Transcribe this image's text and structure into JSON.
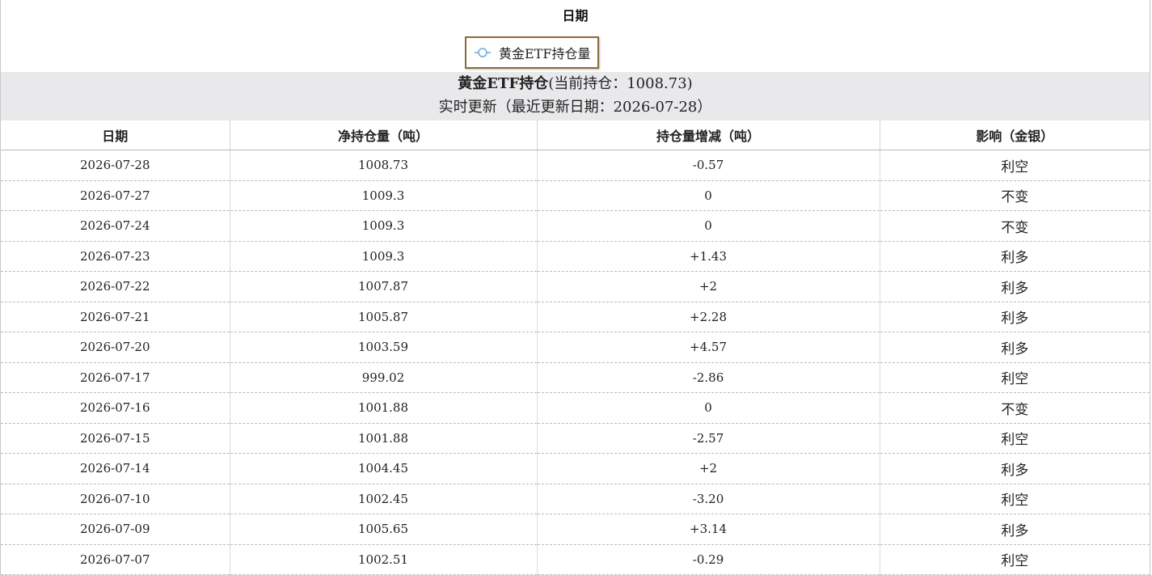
{
  "header": {
    "top_label": "日期",
    "legend_label": "黄金ETF持仓量"
  },
  "summary": {
    "title_bold": "黄金ETF持仓",
    "title_rest": "(当前持仓：1008.73)",
    "update_line": "实时更新（最近更新日期：2026-07-28）"
  },
  "table": {
    "columns": [
      "日期",
      "净持仓量（吨）",
      "持仓量增减（吨）",
      "影响（金银）"
    ],
    "rows": [
      {
        "date": "2026-07-28",
        "holding": "1008.73",
        "change": "-0.57",
        "impact": "利空"
      },
      {
        "date": "2026-07-27",
        "holding": "1009.3",
        "change": "0",
        "impact": "不变"
      },
      {
        "date": "2026-07-24",
        "holding": "1009.3",
        "change": "0",
        "impact": "不变"
      },
      {
        "date": "2026-07-23",
        "holding": "1009.3",
        "change": "+1.43",
        "impact": "利多"
      },
      {
        "date": "2026-07-22",
        "holding": "1007.87",
        "change": "+2",
        "impact": "利多"
      },
      {
        "date": "2026-07-21",
        "holding": "1005.87",
        "change": "+2.28",
        "impact": "利多"
      },
      {
        "date": "2026-07-20",
        "holding": "1003.59",
        "change": "+4.57",
        "impact": "利多"
      },
      {
        "date": "2026-07-17",
        "holding": "999.02",
        "change": "-2.86",
        "impact": "利空"
      },
      {
        "date": "2026-07-16",
        "holding": "1001.88",
        "change": "0",
        "impact": "不变"
      },
      {
        "date": "2026-07-15",
        "holding": "1001.88",
        "change": "-2.57",
        "impact": "利空"
      },
      {
        "date": "2026-07-14",
        "holding": "1004.45",
        "change": "+2",
        "impact": "利多"
      },
      {
        "date": "2026-07-10",
        "holding": "1002.45",
        "change": "-3.20",
        "impact": "利空"
      },
      {
        "date": "2026-07-09",
        "holding": "1005.65",
        "change": "+3.14",
        "impact": "利多"
      },
      {
        "date": "2026-07-07",
        "holding": "1002.51",
        "change": "-0.29",
        "impact": "利空"
      }
    ]
  },
  "colors": {
    "summary_bg": "#e9e9ec",
    "legend_border": "#8b6b3a",
    "legend_icon": "#6fa8dc"
  },
  "icons": {
    "legend": "series-toggle-icon"
  }
}
